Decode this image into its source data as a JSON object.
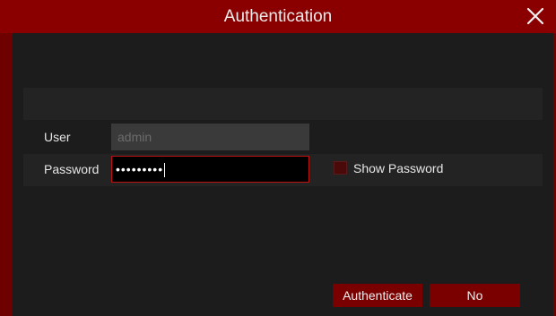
{
  "dialog": {
    "title": "Authentication"
  },
  "form": {
    "user_label": "User",
    "user_value": "admin",
    "password_label": "Password",
    "password_value": "•••••••••",
    "show_password_label": "Show Password"
  },
  "buttons": {
    "authenticate": "Authenticate",
    "no": "No"
  },
  "colors": {
    "title_bar": "#8a0000",
    "frame": "#6e0000",
    "body": "#1c1c1c",
    "button": "#7a0000",
    "focus_border": "#bb1111"
  }
}
